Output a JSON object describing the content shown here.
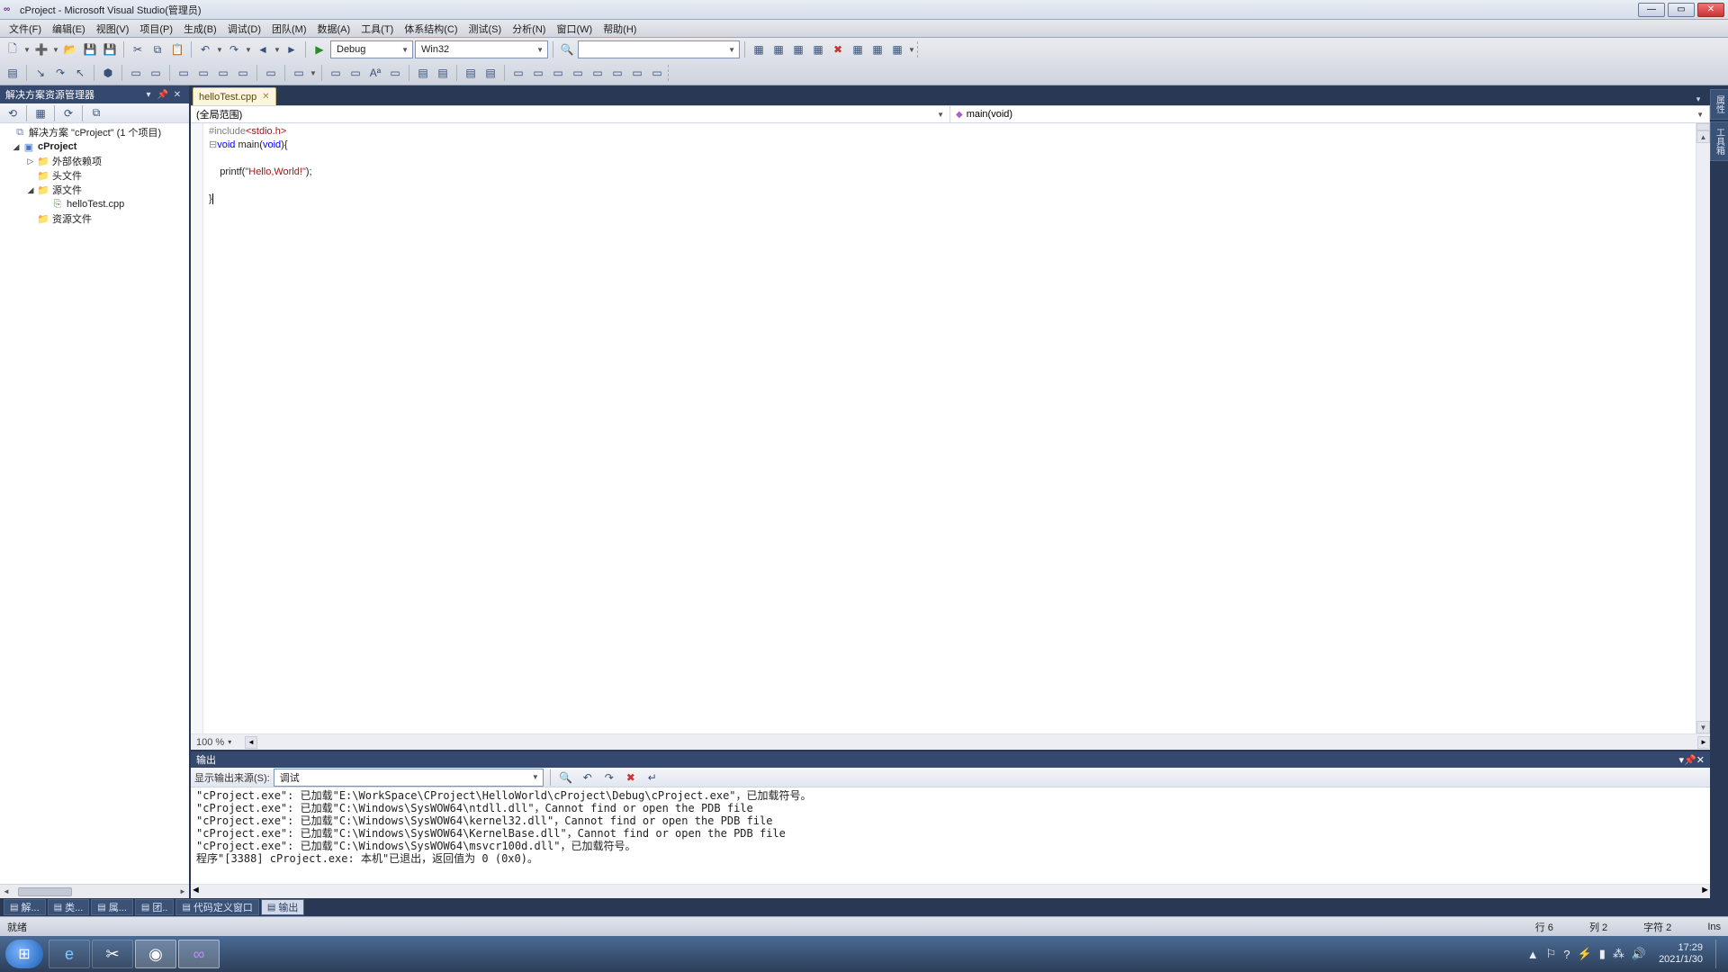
{
  "title": "cProject - Microsoft Visual Studio(管理员)",
  "menus": [
    "文件(F)",
    "编辑(E)",
    "视图(V)",
    "项目(P)",
    "生成(B)",
    "调试(D)",
    "团队(M)",
    "数据(A)",
    "工具(T)",
    "体系结构(C)",
    "测试(S)",
    "分析(N)",
    "窗口(W)",
    "帮助(H)"
  ],
  "toolbar1": {
    "config": "Debug",
    "platform": "Win32",
    "quicklaunch": ""
  },
  "solution_explorer": {
    "title": "解决方案资源管理器",
    "root": "解决方案 \"cProject\" (1 个项目)",
    "project": "cProject",
    "folders": {
      "external": "外部依赖项",
      "headers": "头文件",
      "sources": "源文件",
      "resources": "资源文件"
    },
    "source_file": "helloTest.cpp"
  },
  "editor": {
    "tab": "helloTest.cpp",
    "scope": "(全局范围)",
    "member": "main(void)",
    "zoom": "100 %",
    "code_tokens": {
      "l1a": "#include",
      "l1b": "<stdio.h>",
      "l2a": "void",
      "l2b": " main(",
      "l2c": "void",
      "l2d": "){",
      "l4a": "    printf(",
      "l4b": "\"Hello,World!\"",
      "l4c": ");",
      "l6a": "}"
    }
  },
  "output": {
    "title": "输出",
    "source_label": "显示输出来源(S):",
    "source": "调试",
    "lines": [
      "\"cProject.exe\": 已加载\"E:\\WorkSpace\\CProject\\HelloWorld\\cProject\\Debug\\cProject.exe\"，已加载符号。",
      "\"cProject.exe\": 已加载\"C:\\Windows\\SysWOW64\\ntdll.dll\"，Cannot find or open the PDB file",
      "\"cProject.exe\": 已加载\"C:\\Windows\\SysWOW64\\kernel32.dll\"，Cannot find or open the PDB file",
      "\"cProject.exe\": 已加载\"C:\\Windows\\SysWOW64\\KernelBase.dll\"，Cannot find or open the PDB file",
      "\"cProject.exe\": 已加载\"C:\\Windows\\SysWOW64\\msvcr100d.dll\"，已加载符号。",
      "程序\"[3388] cProject.exe: 本机\"已退出，返回值为 0 (0x0)。"
    ]
  },
  "bottom_tabs": [
    "解...",
    "类...",
    "属...",
    "团..",
    "代码定义窗口",
    "输出"
  ],
  "right_tabs": [
    "属性",
    "工具箱"
  ],
  "status": {
    "ready": "就绪",
    "line": "行 6",
    "col": "列 2",
    "char": "字符 2",
    "ins": "Ins"
  },
  "clock": {
    "time": "17:29",
    "date": "2021/1/30"
  }
}
